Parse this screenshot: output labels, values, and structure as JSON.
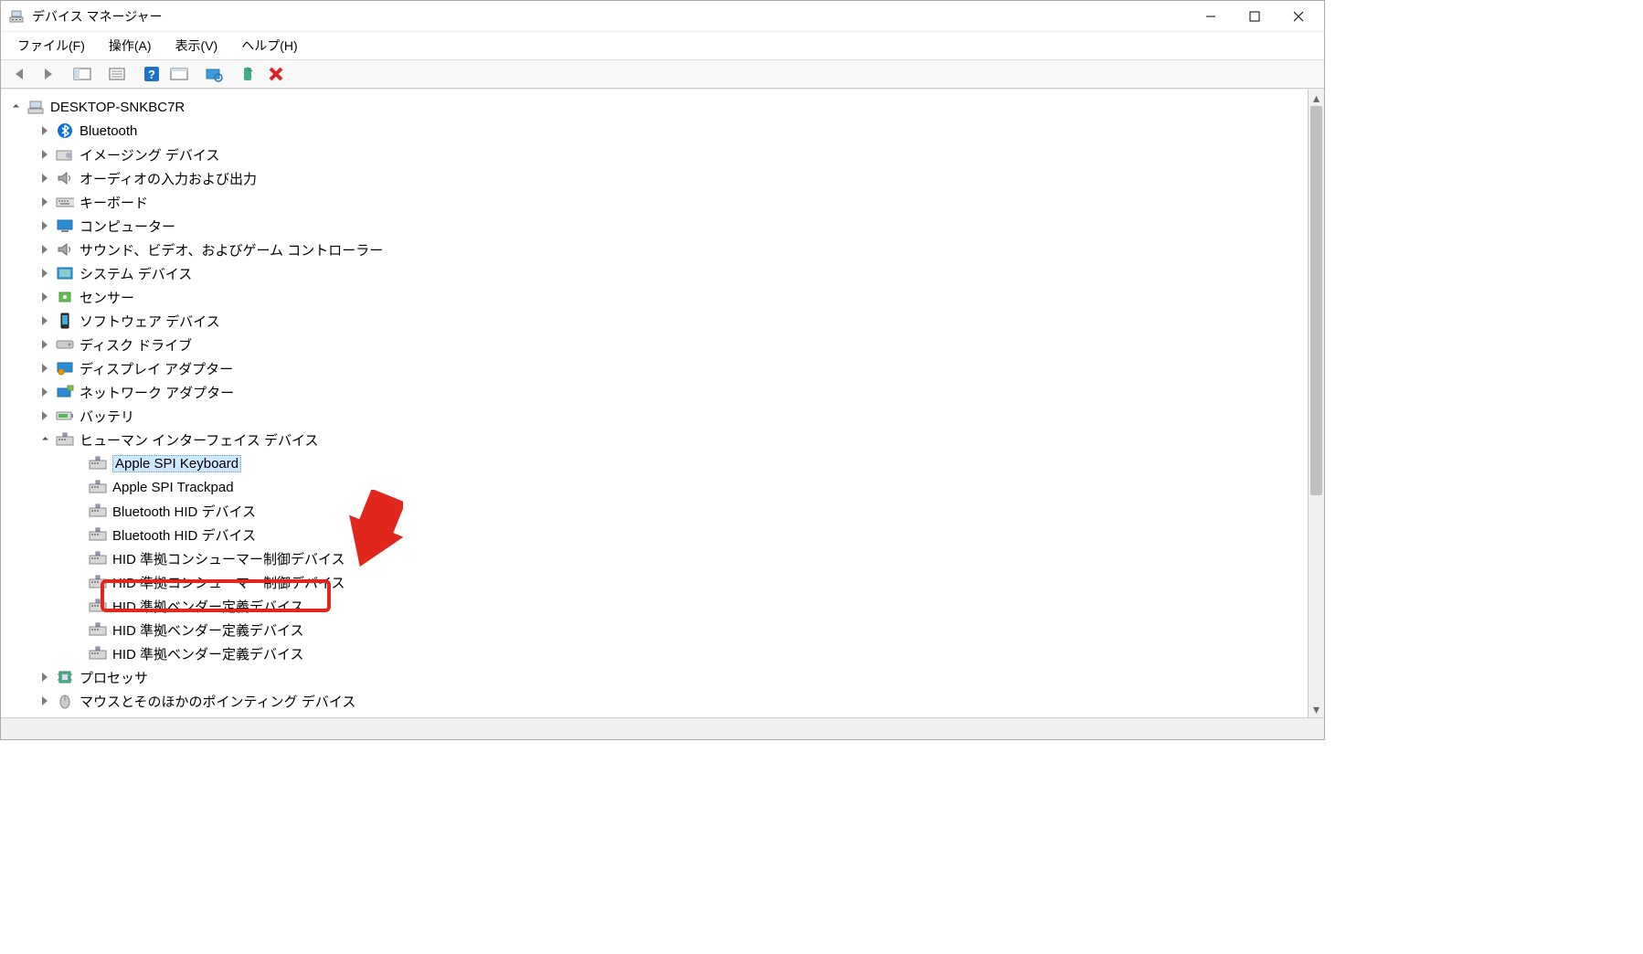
{
  "window": {
    "title": "デバイス マネージャー"
  },
  "menubar": [
    {
      "label": "ファイル(F)"
    },
    {
      "label": "操作(A)"
    },
    {
      "label": "表示(V)"
    },
    {
      "label": "ヘルプ(H)"
    }
  ],
  "tree": {
    "root": {
      "label": "DESKTOP-SNKBC7R",
      "expanded": true
    },
    "categories": [
      {
        "label": "Bluetooth",
        "icon": "bluetooth",
        "expanded": false
      },
      {
        "label": "イメージング デバイス",
        "icon": "imaging",
        "expanded": false
      },
      {
        "label": "オーディオの入力および出力",
        "icon": "audio",
        "expanded": false
      },
      {
        "label": "キーボード",
        "icon": "keyboard",
        "expanded": false
      },
      {
        "label": "コンピューター",
        "icon": "computer",
        "expanded": false
      },
      {
        "label": "サウンド、ビデオ、およびゲーム コントローラー",
        "icon": "sound",
        "expanded": false
      },
      {
        "label": "システム デバイス",
        "icon": "system",
        "expanded": false
      },
      {
        "label": "センサー",
        "icon": "sensor",
        "expanded": false
      },
      {
        "label": "ソフトウェア デバイス",
        "icon": "software",
        "expanded": false
      },
      {
        "label": "ディスク ドライブ",
        "icon": "disk",
        "expanded": false
      },
      {
        "label": "ディスプレイ アダプター",
        "icon": "display",
        "expanded": false
      },
      {
        "label": "ネットワーク アダプター",
        "icon": "network",
        "expanded": false
      },
      {
        "label": "バッテリ",
        "icon": "battery",
        "expanded": false
      },
      {
        "label": "ヒューマン インターフェイス デバイス",
        "icon": "hid",
        "expanded": true,
        "children": [
          {
            "label": "Apple SPI Keyboard",
            "icon": "hid",
            "selected": true
          },
          {
            "label": "Apple SPI Trackpad",
            "icon": "hid",
            "highlighted": true
          },
          {
            "label": "Bluetooth HID デバイス",
            "icon": "hid"
          },
          {
            "label": "Bluetooth HID デバイス",
            "icon": "hid"
          },
          {
            "label": "HID 準拠コンシューマー制御デバイス",
            "icon": "hid"
          },
          {
            "label": "HID 準拠コンシューマー制御デバイス",
            "icon": "hid"
          },
          {
            "label": "HID 準拠ベンダー定義デバイス",
            "icon": "hid"
          },
          {
            "label": "HID 準拠ベンダー定義デバイス",
            "icon": "hid"
          },
          {
            "label": "HID 準拠ベンダー定義デバイス",
            "icon": "hid"
          }
        ]
      },
      {
        "label": "プロセッサ",
        "icon": "processor",
        "expanded": false
      },
      {
        "label": "マウスとそのほかのポインティング デバイス",
        "icon": "mouse",
        "expanded": false
      }
    ]
  },
  "annotation": {
    "arrow_color": "#e1261c",
    "box_color": "#e1261c"
  }
}
